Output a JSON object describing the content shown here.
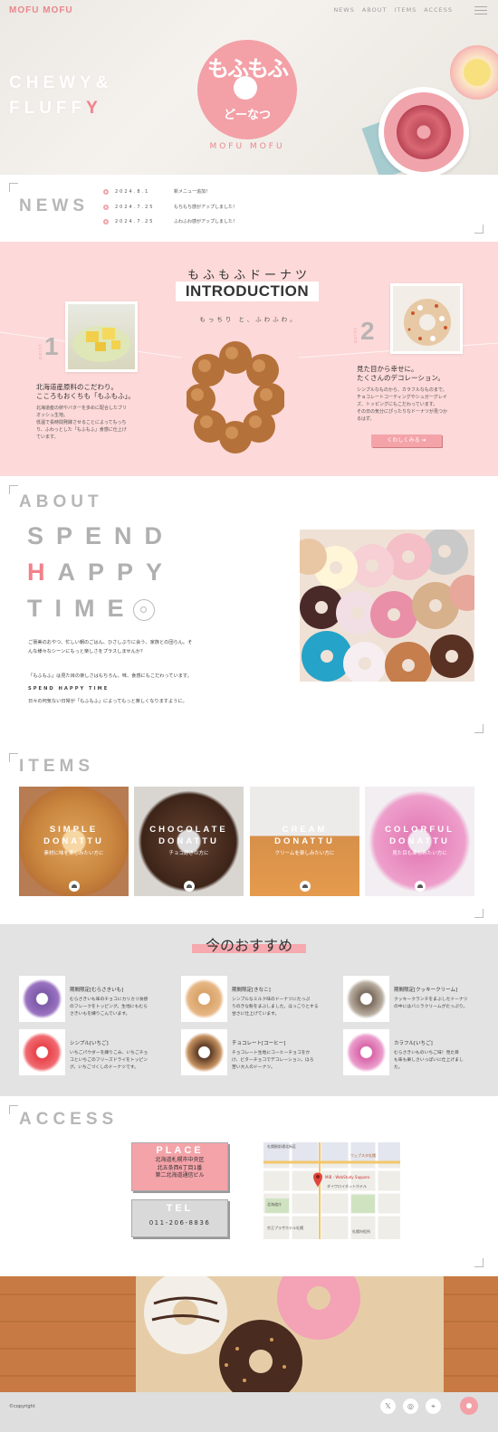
{
  "header": {
    "logo": "MOFU MOFU",
    "nav": [
      "NEWS",
      "ABOUT",
      "ITEMS",
      "ACCESS"
    ]
  },
  "hero": {
    "catch_line1": "CHEWY&",
    "catch_line2_main": "FLUFF",
    "catch_line2_accent": "Y",
    "logo_line1": "もふもふ",
    "logo_line2": "どーなつ",
    "logo_sub": "MOFU MOFU"
  },
  "news": {
    "title": "NEWS",
    "items": [
      {
        "date": "2024.8.1",
        "text": "新メニュー追加！"
      },
      {
        "date": "2024.7.25",
        "text": "もちもち感がアップしました！"
      },
      {
        "date": "2024.7.25",
        "text": "ふわふわ感がアップしました！"
      }
    ]
  },
  "intro": {
    "title_jp": "もふもふドーナツ",
    "title_en": "INTRODUCTION",
    "subtitle": "もっちり と、ふわふわ。",
    "point1": {
      "label": "point",
      "num": "1",
      "title1": "北海道産原料のこだわり。",
      "title2": "こころもおくちも「もふもふ」。",
      "body": [
        "北海道産の卵やバターを多めに配合したブリ",
        "オッシュ生地。",
        "低温で長時間発酵させることによってもっち",
        "り、ふわっとした「もふもふ」食感に仕上げ",
        "ています。"
      ]
    },
    "point2": {
      "label": "point",
      "num": "2",
      "title1": "見た目から幸せに。",
      "title2": "たくさんのデコレーション。",
      "body": [
        "シンプルなものから、カラフルなものまで。",
        "チョコレートコーティングやシュガーグレイ",
        "ズ、トッピングにもこだわっています。",
        "その日の気分にぴったりなドーナツが見つか",
        "るはず。"
      ]
    },
    "more_button": "くわしくみる"
  },
  "about": {
    "title": "ABOUT",
    "line1": "SPEND",
    "line2_accent": "H",
    "line2_rest": "APPY",
    "line3": "TIME",
    "p1": [
      "ご褒美のおやつ、忙しい朝のごはん、ひさしぶりに会う、家族との団らん。そ",
      "んな様々なシーンにもっと楽しさをプラスしませんか？"
    ],
    "p2": "「もふもふ」は見た目の楽しさはもちろん、味、食感にもこだわっています。",
    "p3": "SPEND HAPPY TIME",
    "p4": "日々の何気ない日常が「もふもふ」によってもっと楽しくなりますように。"
  },
  "items": {
    "title": "ITEMS",
    "cards": [
      {
        "line1": "SIMPLE",
        "line2": "DONATTU",
        "sub": "素材に味を楽しみたい方に"
      },
      {
        "line1": "CHOCOLATE",
        "line2": "DONATTU",
        "sub": "チョコ好きの方に"
      },
      {
        "line1": "CREAM",
        "line2": "DONATTU",
        "sub": "クリームを楽しみたい方に"
      },
      {
        "line1": "COLORFUL",
        "line2": "DONATTU",
        "sub": "見た目も楽しみたい方に"
      }
    ]
  },
  "recommend": {
    "title": "今のおすすめ",
    "items": [
      {
        "name": "期間限定[むらさきいも]",
        "desc": [
          "むらさきいも味のチョコにカリカリ食感",
          "のフレークをトッピング。生地にもむら",
          "さきいもを練りこんでいます。"
        ]
      },
      {
        "name": "期間限定[きなこ]",
        "desc": [
          "シンプルなミルク味のドーナツにたっぷ",
          "りのきな粉をまぶしました。ほっこりとする",
          "甘さに仕上げています。"
        ]
      },
      {
        "name": "期間限定[クッキークリーム]",
        "desc": [
          "クッキークランチをまぶしたドーナツ",
          "の中にはバニラクリームがたっぷり。"
        ]
      },
      {
        "name": "シンプル[いちご]",
        "desc": [
          "いちごパウダーを練りこみ、いちごチョ",
          "コといちごのフリーズドライをトッピン",
          "グ。いちごづくしのドーナツです。"
        ]
      },
      {
        "name": "チョコレート[コーヒー]",
        "desc": [
          "チョコレート生地にコーヒーチョコをか",
          "け、ビターチョコでデコレーション。ほろ",
          "苦い大人のドーナツ。"
        ]
      },
      {
        "name": "カラフル[いちご]",
        "desc": [
          "むらさきいものいちご味！見た目",
          "も味も楽しさいっぱいに仕上げまし",
          "た。"
        ]
      }
    ]
  },
  "access": {
    "title": "ACCESS",
    "place_label": "PLACE",
    "address": [
      "北海道札幌市中央区",
      "北五条西6丁目1番",
      "第二北海道通信ビル"
    ],
    "tel_label": "TEL",
    "tel": "011-206-8836",
    "map_labels": [
      "札幌駅前通北街区",
      "ウェブスタ札幌",
      "MIB - WebStudy Sapporo",
      "ダイワロイネットホテル",
      "北海道庁",
      "京王プラザホテル札幌",
      "札幌市役所"
    ]
  },
  "footer": {
    "copyright": "©copyright",
    "icons": [
      "x-icon",
      "instagram-icon",
      "map-pin-icon"
    ]
  },
  "colors": {
    "accent_pink": "#f2818a",
    "light_pink_bg": "#fdd9d9",
    "gray_title": "#b7b7b7",
    "reco_bg": "#e3e3e3"
  }
}
